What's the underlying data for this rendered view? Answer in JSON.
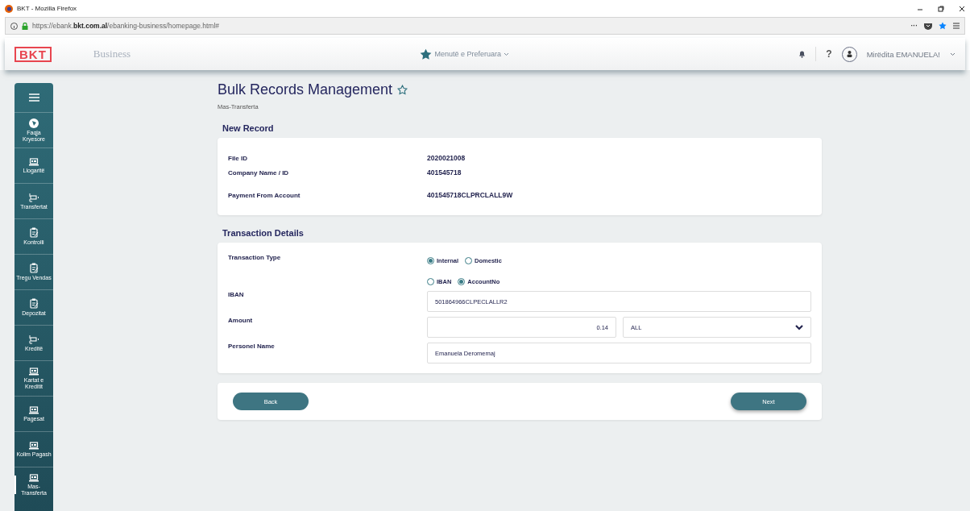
{
  "browser": {
    "title": "BKT - Mozilla Firefox",
    "url_prefix": "https://ebank.",
    "url_domain": "bkt.com.al",
    "url_path": "/ebanking-business/homepage.html#",
    "toolbar_more": "···"
  },
  "header": {
    "logo": "BKT",
    "product": "Business",
    "favorites": "Menutë e Preferuara",
    "help": "?",
    "greeting": "Mirëdita EMANUELA!"
  },
  "sidebar": {
    "items": [
      {
        "label": "Faqja Kryesore",
        "kind": "home",
        "selected": false
      },
      {
        "label": "Llogaritë",
        "kind": "laptop",
        "selected": false
      },
      {
        "label": "Transfertat",
        "kind": "transfer",
        "selected": false
      },
      {
        "label": "Kontrolli",
        "kind": "clipboard",
        "selected": false
      },
      {
        "label": "Tregu Vendas",
        "kind": "clipboard",
        "selected": false
      },
      {
        "label": "Depozitat",
        "kind": "clipboard",
        "selected": false
      },
      {
        "label": "Kreditë",
        "kind": "transfer",
        "selected": false
      },
      {
        "label": "Kartat e Kreditit",
        "kind": "laptop",
        "selected": false
      },
      {
        "label": "Pagesat",
        "kind": "laptop",
        "selected": false
      },
      {
        "label": "Kolim Pagash",
        "kind": "laptop",
        "selected": false
      },
      {
        "label": "Mas-Transferta",
        "kind": "laptop",
        "selected": true
      }
    ]
  },
  "page": {
    "title": "Bulk Records Management",
    "breadcrumb": "Mas-Transferta"
  },
  "new_record": {
    "title": "New Record",
    "rows": [
      {
        "label": "File ID",
        "value": "2020021008"
      },
      {
        "label": "Company Name / ID",
        "value": "401545718"
      },
      {
        "label": "Payment From Account",
        "value": "401545718CLPRCLALL9W"
      }
    ]
  },
  "transaction_details": {
    "title": "Transaction Details",
    "transaction_type": {
      "label": "Transaction Type",
      "options": [
        {
          "label": "Internal",
          "selected": true
        },
        {
          "label": "Domestic",
          "selected": false
        }
      ]
    },
    "account_type": {
      "options": [
        {
          "label": "IBAN",
          "selected": false
        },
        {
          "label": "AccountNo",
          "selected": true
        }
      ]
    },
    "iban": {
      "label": "IBAN",
      "value": "501864966CLPECLALLR2"
    },
    "amount": {
      "label": "Amount",
      "value": "0.14",
      "currency": "ALL"
    },
    "personel_name": {
      "label": "Personel Name",
      "value": "Emanuela Deromemaj"
    }
  },
  "buttons": [
    {
      "label": "Back"
    },
    {
      "label": "Next"
    }
  ]
}
